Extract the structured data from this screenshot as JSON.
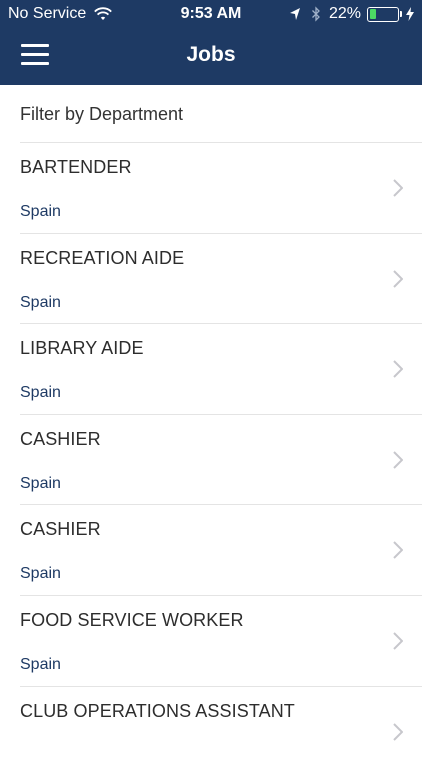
{
  "status_bar": {
    "carrier": "No Service",
    "time": "9:53 AM",
    "battery_percent": "22%",
    "battery_level": 0.22
  },
  "nav": {
    "title": "Jobs",
    "menu_icon": "hamburger-menu-icon"
  },
  "filter": {
    "label": "Filter by Department"
  },
  "jobs": [
    {
      "title": "BARTENDER",
      "location": "Spain"
    },
    {
      "title": "RECREATION AIDE",
      "location": "Spain"
    },
    {
      "title": "LIBRARY AIDE",
      "location": "Spain"
    },
    {
      "title": "CASHIER",
      "location": "Spain"
    },
    {
      "title": "CASHIER",
      "location": "Spain"
    },
    {
      "title": "FOOD SERVICE WORKER",
      "location": "Spain"
    },
    {
      "title": "CLUB OPERATIONS ASSISTANT",
      "location": ""
    }
  ],
  "colors": {
    "header_bg": "#1e3a64",
    "accent": "#1e3a64",
    "battery": "#4cd964"
  }
}
